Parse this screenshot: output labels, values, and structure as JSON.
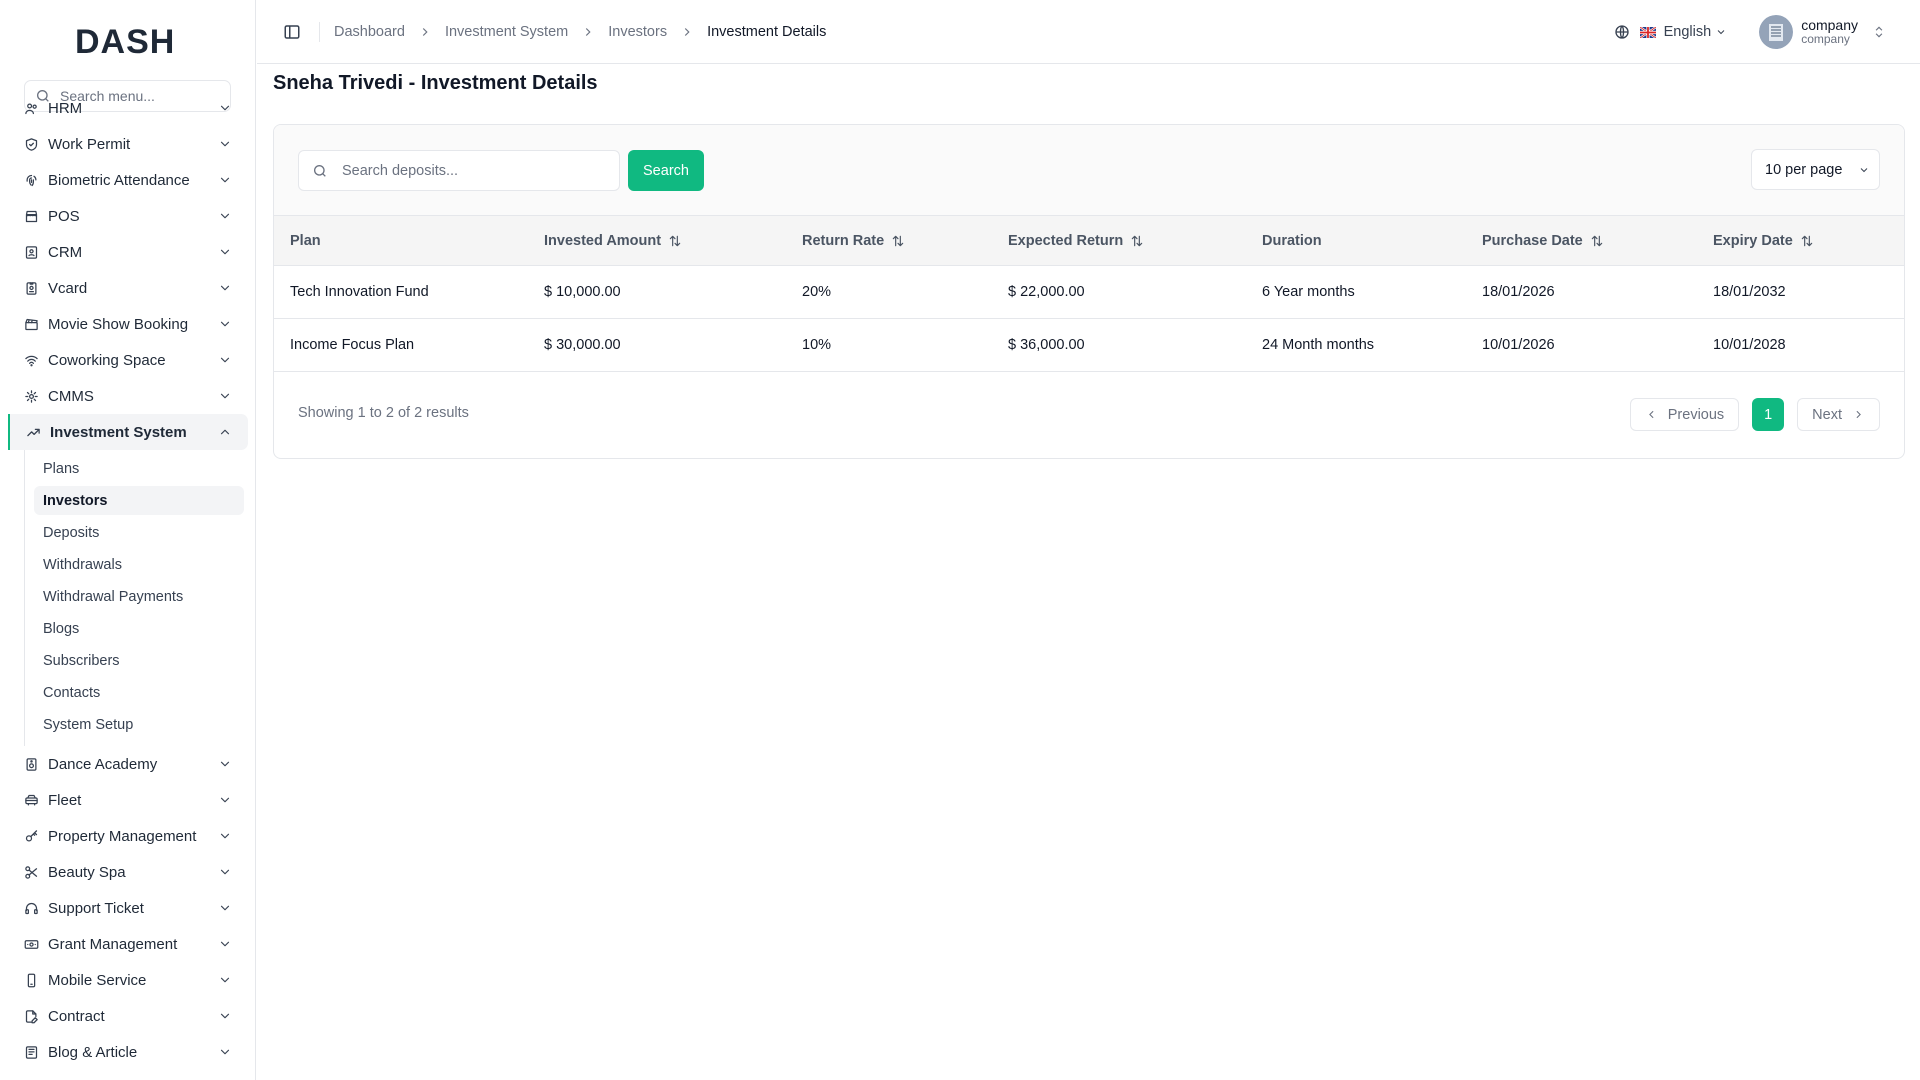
{
  "app": {
    "logo_text": "DASH"
  },
  "sidebar": {
    "search_placeholder": "Search menu...",
    "items_top": [
      {
        "label": "HRM",
        "icon": "users-icon"
      },
      {
        "label": "Work Permit",
        "icon": "shield-check-icon"
      },
      {
        "label": "Biometric Attendance",
        "icon": "fingerprint-icon"
      },
      {
        "label": "POS",
        "icon": "store-icon"
      },
      {
        "label": "CRM",
        "icon": "contact-card-icon"
      },
      {
        "label": "Vcard",
        "icon": "badge-icon"
      },
      {
        "label": "Movie Show Booking",
        "icon": "clapperboard-icon"
      },
      {
        "label": "Coworking Space",
        "icon": "wifi-icon"
      },
      {
        "label": "CMMS",
        "icon": "cog-icon"
      }
    ],
    "active_group": {
      "label": "Investment System",
      "icon": "trending-up-icon",
      "children": [
        "Plans",
        "Investors",
        "Deposits",
        "Withdrawals",
        "Withdrawal Payments",
        "Blogs",
        "Subscribers",
        "Contacts",
        "System Setup"
      ],
      "active_child": "Investors"
    },
    "items_bottom": [
      {
        "label": "Dance Academy",
        "icon": "speaker-icon"
      },
      {
        "label": "Fleet",
        "icon": "car-icon"
      },
      {
        "label": "Property Management",
        "icon": "key-icon"
      },
      {
        "label": "Beauty Spa",
        "icon": "scissors-icon"
      },
      {
        "label": "Support Ticket",
        "icon": "headphones-icon"
      },
      {
        "label": "Grant Management",
        "icon": "banknote-icon"
      },
      {
        "label": "Mobile Service",
        "icon": "smartphone-icon"
      },
      {
        "label": "Contract",
        "icon": "file-pen-icon"
      },
      {
        "label": "Blog & Article",
        "icon": "newspaper-icon"
      }
    ]
  },
  "header": {
    "breadcrumb": [
      "Dashboard",
      "Investment System",
      "Investors",
      "Investment Details"
    ],
    "language": "English",
    "user": {
      "name": "company",
      "role": "company"
    }
  },
  "page": {
    "title": "Sneha Trivedi - Investment Details",
    "search_placeholder": "Search deposits...",
    "search_button": "Search",
    "per_page": "10 per page"
  },
  "table": {
    "columns": [
      {
        "label": "Plan",
        "sortable": false
      },
      {
        "label": "Invested Amount",
        "sortable": true
      },
      {
        "label": "Return Rate",
        "sortable": true
      },
      {
        "label": "Expected Return",
        "sortable": true
      },
      {
        "label": "Duration",
        "sortable": false
      },
      {
        "label": "Purchase Date",
        "sortable": true
      },
      {
        "label": "Expiry Date",
        "sortable": true
      }
    ],
    "rows": [
      [
        "Tech Innovation Fund",
        "$ 10,000.00",
        "20%",
        "$ 22,000.00",
        "6 Year months",
        "18/01/2026",
        "18/01/2032"
      ],
      [
        "Income Focus Plan",
        "$ 30,000.00",
        "10%",
        "$ 36,000.00",
        "24 Month months",
        "10/01/2026",
        "10/01/2028"
      ]
    ]
  },
  "pagination": {
    "summary": "Showing 1 to 2 of 2 results",
    "previous": "Previous",
    "current": "1",
    "next": "Next"
  },
  "colors": {
    "accent": "#10b981",
    "text": "#111827",
    "muted": "#6b7280",
    "border": "#e5e7eb"
  }
}
